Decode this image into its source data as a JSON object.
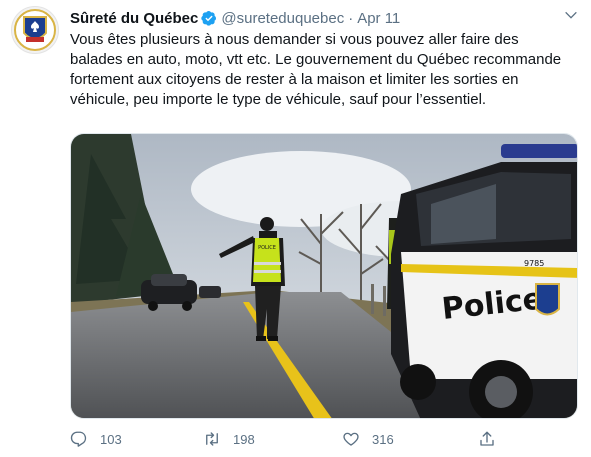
{
  "tweet": {
    "author_name": "Sûreté du Québec",
    "handle": "@sureteduquebec",
    "separator": "·",
    "date": "Apr 11",
    "text": "Vous êtes plusieurs à nous demander si vous pouvez aller faire des balades en auto, moto, vtt etc. Le gouvernement du Québec recommande fortement aux citoyens de rester à la maison et limiter les sorties en véhicule, peu importe le type de véhicule, sauf pour l’essentiel.",
    "media": {
      "vest_text": "POLICE",
      "car_text": "Police",
      "car_plate": "9785"
    },
    "counts": {
      "replies": "103",
      "retweets": "198",
      "likes": "316"
    }
  },
  "colors": {
    "verified": "#1da1f2",
    "secondary_text": "#5b7083",
    "vest": "#c6e21b"
  },
  "icons": [
    "verified-badge-icon",
    "chevron-down-icon",
    "reply-icon",
    "retweet-icon",
    "like-icon",
    "share-icon"
  ]
}
